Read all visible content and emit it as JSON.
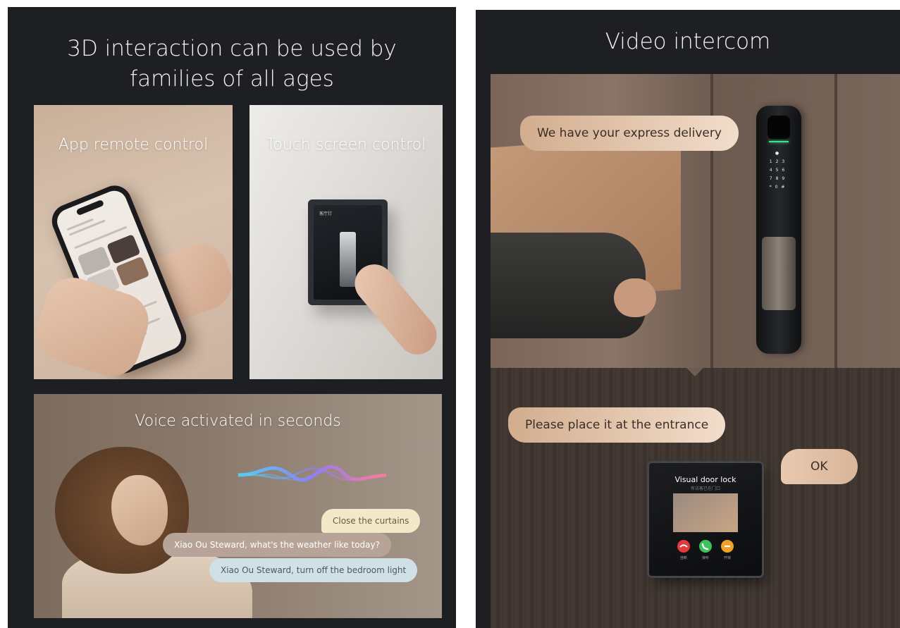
{
  "left_panel": {
    "title_line1": "3D interaction can be used by",
    "title_line2": "families of all ages",
    "app_card": {
      "label": "App remote control"
    },
    "touch_card": {
      "label": "Touch screen control",
      "screen_text": "客厅灯"
    },
    "voice_card": {
      "label": "Voice activated in seconds",
      "bubbles": [
        "Close the curtains",
        "Xiao Ou Steward, what's the weather like today?",
        "Xiao Ou Steward, turn off the bedroom light"
      ]
    }
  },
  "right_panel": {
    "title": "Video intercom",
    "bubble_express": "We have your express delivery",
    "bubble_place": "Please place it at the entrance",
    "bubble_ok": "OK",
    "intercom": {
      "title": "Visual door lock",
      "subtitle": "有访客已在门口",
      "buttons": [
        "挂断",
        "接听",
        "开锁"
      ]
    }
  },
  "colors": {
    "panel_bg": "#1e1f22",
    "speech_bubble": "#e6c8b0",
    "call_red": "#e23b3b",
    "call_green": "#3cc45a",
    "call_orange": "#f0a12c"
  }
}
